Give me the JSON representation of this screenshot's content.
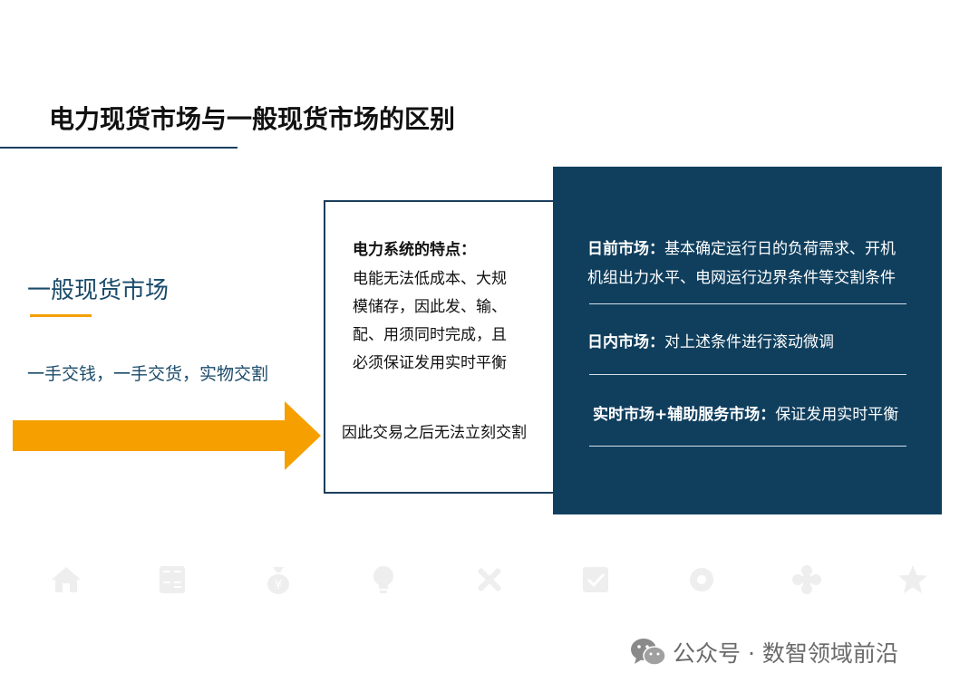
{
  "title": "电力现货市场与一般现货市场的区别",
  "left": {
    "heading": "一般现货市场",
    "description": "一手交钱，一手交货，实物交割"
  },
  "middle": {
    "heading": "电力系统的特点：",
    "body_lines": [
      "电能无法低成本、大规",
      "模储存，因此发、输、",
      "配、用须同时完成，且",
      "必须保证发用实时平衡"
    ],
    "conclusion": "因此交易之后无法立刻交割"
  },
  "right": {
    "markets": [
      {
        "name": "日前市场：",
        "desc_line1": "基本确定运行日的负荷需求、开机",
        "desc_line2": "机组出力水平、电网运行边界条件等交割条件"
      },
      {
        "name": "日内市场：",
        "desc_line1": "对上述条件进行滚动微调",
        "desc_line2": ""
      },
      {
        "name": "实时市场+辅助服务市场：",
        "desc_line1": "保证发用实时平衡",
        "desc_line2": ""
      }
    ]
  },
  "ghost_icons": [
    "home-icon",
    "calculator-icon",
    "money-bag-icon",
    "lightbulb-icon",
    "tools-icon",
    "checkbox-icon",
    "gear-icon",
    "flower-icon",
    "star-icon"
  ],
  "watermark": {
    "text": "公众号 · 数智领域前沿",
    "icon": "wechat-icon"
  },
  "colors": {
    "navy": "#103f5e",
    "accent_orange": "#f5a000",
    "heading_blue": "#1a4a6a"
  }
}
